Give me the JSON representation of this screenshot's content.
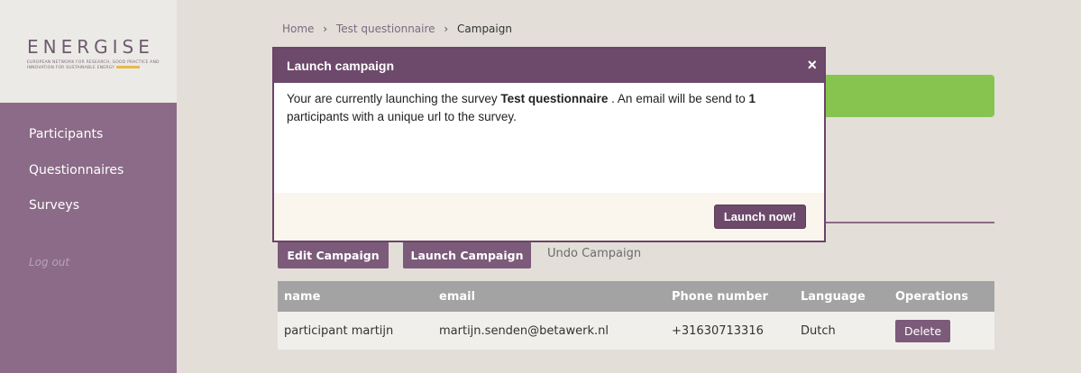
{
  "sidebar": {
    "logo": {
      "title": "ENERGISE",
      "subtitle": "EUROPEAN NETWORK FOR RESEARCH, GOOD PRACTICE AND INNOVATION FOR SUSTAINABLE ENERGY"
    },
    "items": [
      {
        "label": "Participants"
      },
      {
        "label": "Questionnaires"
      },
      {
        "label": "Surveys"
      }
    ],
    "logout": "Log out"
  },
  "breadcrumb": {
    "items": [
      "Home",
      "Test questionnaire",
      "Campaign"
    ],
    "separator": "›"
  },
  "actions": {
    "edit": "Edit Campaign",
    "launch": "Launch Campaign",
    "undo": "Undo Campaign"
  },
  "table": {
    "headers": [
      "name",
      "email",
      "Phone number",
      "Language",
      "Operations"
    ],
    "rows": [
      {
        "name": "participant martijn",
        "email": "martijn.senden@betawerk.nl",
        "phone": "+31630713316",
        "language": "Dutch",
        "operation": "Delete"
      }
    ]
  },
  "modal": {
    "title": "Launch campaign",
    "close": "×",
    "body": {
      "text1": "Your are currently launching the survey ",
      "survey_name": "Test questionnaire",
      "text2": " . An email will be send to ",
      "count": "1",
      "text3": " participants with a unique url to the survey."
    },
    "confirm": "Launch now!"
  },
  "colors": {
    "accent": "#7c5a7a",
    "success": "#87c44f",
    "sidebar": "#8b6b87"
  }
}
